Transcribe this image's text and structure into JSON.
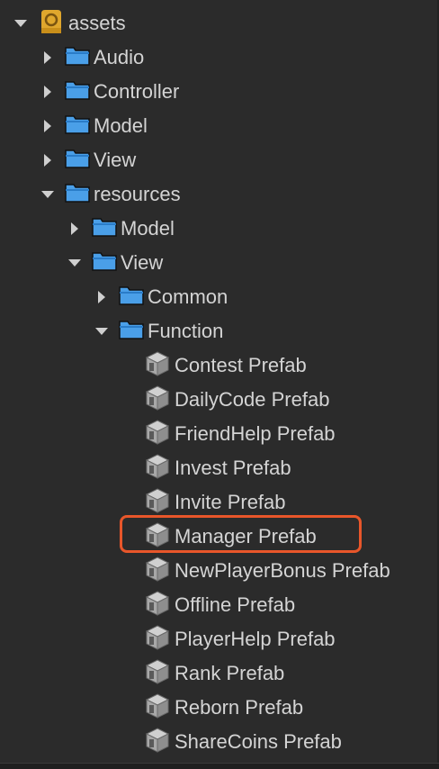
{
  "tree": {
    "root": {
      "label": "assets",
      "icon": "project-root-icon"
    },
    "items": [
      {
        "label": "Audio",
        "icon": "folder-icon",
        "expanded": false
      },
      {
        "label": "Controller",
        "icon": "folder-icon",
        "expanded": false
      },
      {
        "label": "Model",
        "icon": "folder-icon",
        "expanded": false
      },
      {
        "label": "View",
        "icon": "folder-icon",
        "expanded": false
      },
      {
        "label": "resources",
        "icon": "folder-icon",
        "expanded": true
      },
      {
        "label": "Model",
        "icon": "folder-icon",
        "expanded": false
      },
      {
        "label": "View",
        "icon": "folder-icon",
        "expanded": true
      },
      {
        "label": "Common",
        "icon": "folder-icon",
        "expanded": false
      },
      {
        "label": "Function",
        "icon": "folder-icon",
        "expanded": true
      },
      {
        "label": "Contest Prefab",
        "icon": "prefab-cube-icon"
      },
      {
        "label": "DailyCode Prefab",
        "icon": "prefab-cube-icon"
      },
      {
        "label": "FriendHelp Prefab",
        "icon": "prefab-cube-icon"
      },
      {
        "label": "Invest Prefab",
        "icon": "prefab-cube-icon"
      },
      {
        "label": "Invite Prefab",
        "icon": "prefab-cube-icon"
      },
      {
        "label": "Manager Prefab",
        "icon": "prefab-cube-icon",
        "highlighted": true
      },
      {
        "label": "NewPlayerBonus Prefab",
        "icon": "prefab-cube-icon"
      },
      {
        "label": "Offline Prefab",
        "icon": "prefab-cube-icon"
      },
      {
        "label": "PlayerHelp Prefab",
        "icon": "prefab-cube-icon"
      },
      {
        "label": "Rank Prefab",
        "icon": "prefab-cube-icon"
      },
      {
        "label": "Reborn Prefab",
        "icon": "prefab-cube-icon"
      },
      {
        "label": "ShareCoins Prefab",
        "icon": "prefab-cube-icon"
      }
    ]
  },
  "colors": {
    "background": "#2b2b2b",
    "text": "#d4d4d4",
    "folder": "#4a9fe8",
    "root_icon": "#e0a72d",
    "highlight": "#e8562a",
    "prefab": "#b8b8b8"
  }
}
